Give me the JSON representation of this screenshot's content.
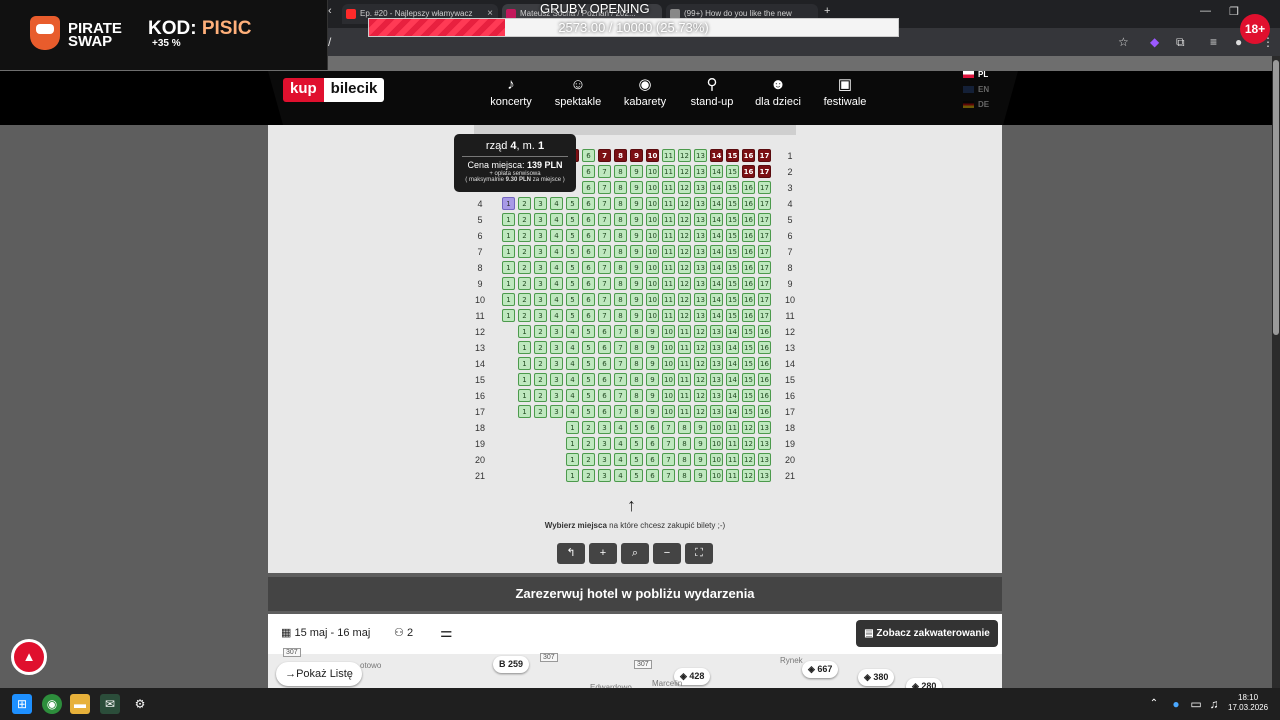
{
  "browser": {
    "tabs": [
      {
        "title": "Ep. #20 - Najlepszy włamywacz",
        "color": "#ff2a2a"
      },
      {
        "title": "Mateusz Socha / Poznań / 202...",
        "color": "#c2185b"
      },
      {
        "title": "(99+) How do you like the new",
        "color": "#888888"
      }
    ],
    "new_tab": "+",
    "url_fragment": "/"
  },
  "overlay": {
    "brand": "PIRATE SWAP",
    "code_prefix": "KOD:",
    "code": "PISIC",
    "bonus": "+35 %",
    "goal_title": "GRUBY OPENING",
    "goal_text": "2573.00 / 10000 (25.73%)",
    "goal_progress": 0.2573,
    "age": "18+"
  },
  "site": {
    "logo_left": "kup",
    "logo_right": "bilecik",
    "nav": [
      {
        "label": "koncerty",
        "icon": "music-note-icon",
        "glyph": "♪"
      },
      {
        "label": "spektakle",
        "icon": "theater-masks-icon",
        "glyph": "☺"
      },
      {
        "label": "kabarety",
        "icon": "speech-bubble-icon",
        "glyph": "◉"
      },
      {
        "label": "stand-up",
        "icon": "microphone-icon",
        "glyph": "⚲"
      },
      {
        "label": "dla dzieci",
        "icon": "child-face-icon",
        "glyph": "☻"
      },
      {
        "label": "festiwale",
        "icon": "speaker-icon",
        "glyph": "▣"
      }
    ],
    "languages": [
      {
        "code": "PL",
        "active": true
      },
      {
        "code": "EN",
        "active": false
      },
      {
        "code": "DE",
        "active": false
      }
    ]
  },
  "seatmap": {
    "tooltip": {
      "row_label": "rząd",
      "row": "4",
      "seat_label": "m.",
      "seat": "1",
      "price_label": "Cena miejsca:",
      "price": "139 PLN",
      "fee": "+ opłata serwisowa",
      "max_prefix": "( maksymalnie",
      "max_fee": "9.30 PLN",
      "max_suffix": "za miejsce )"
    },
    "rows": [
      {
        "row": "1",
        "start": 1,
        "count": 17,
        "taken": [
          1,
          2,
          3,
          4,
          5,
          7,
          8,
          9,
          10,
          14,
          15,
          16,
          17
        ],
        "hidden": [
          1,
          2,
          3,
          4
        ]
      },
      {
        "row": "2",
        "start": 1,
        "count": 17,
        "taken": [
          16,
          17
        ],
        "hidden": [
          1,
          2,
          3,
          4,
          5
        ]
      },
      {
        "row": "3",
        "start": 1,
        "count": 17,
        "taken": [],
        "hidden": [
          1,
          2,
          3,
          4,
          5
        ]
      },
      {
        "row": "4",
        "start": 1,
        "count": 17,
        "taken": [],
        "selected": [
          1
        ]
      },
      {
        "row": "5",
        "start": 1,
        "count": 17,
        "taken": []
      },
      {
        "row": "6",
        "start": 1,
        "count": 17,
        "taken": []
      },
      {
        "row": "7",
        "start": 1,
        "count": 17,
        "taken": []
      },
      {
        "row": "8",
        "start": 1,
        "count": 17,
        "taken": []
      },
      {
        "row": "9",
        "start": 1,
        "count": 17,
        "taken": []
      },
      {
        "row": "10",
        "start": 1,
        "count": 17,
        "taken": []
      },
      {
        "row": "11",
        "start": 1,
        "count": 17,
        "taken": []
      },
      {
        "row": "12",
        "start": 2,
        "count": 16,
        "taken": []
      },
      {
        "row": "13",
        "start": 2,
        "count": 16,
        "taken": []
      },
      {
        "row": "14",
        "start": 2,
        "count": 16,
        "taken": []
      },
      {
        "row": "15",
        "start": 2,
        "count": 16,
        "taken": []
      },
      {
        "row": "16",
        "start": 2,
        "count": 16,
        "taken": []
      },
      {
        "row": "17",
        "start": 2,
        "count": 16,
        "taken": []
      },
      {
        "row": "18",
        "start": 5,
        "count": 13,
        "taken": []
      },
      {
        "row": "19",
        "start": 5,
        "count": 13,
        "taken": []
      },
      {
        "row": "20",
        "start": 5,
        "count": 13,
        "taken": []
      },
      {
        "row": "21",
        "start": 5,
        "count": 13,
        "taken": []
      }
    ],
    "choose_bold": "Wybierz miejsca",
    "choose_rest": " na które chcesz zakupić bilety ;-)",
    "tools": [
      {
        "name": "undo-button",
        "glyph": "↰"
      },
      {
        "name": "add-button",
        "glyph": "+"
      },
      {
        "name": "zoom-out-button",
        "glyph": "⌕"
      },
      {
        "name": "remove-button",
        "glyph": "−"
      },
      {
        "name": "fullscreen-button",
        "glyph": "⛶"
      }
    ]
  },
  "hotel": {
    "title": "Zarezerwuj hotel w pobliżu wydarzenia",
    "dates": "15 maj - 16 maj",
    "guests": "2",
    "show_button": "Zobacz zakwaterowanie",
    "list_button": "Pokaż Listę",
    "pins": [
      "259",
      "428",
      "667",
      "380",
      "280"
    ],
    "roads": [
      "307",
      "307",
      "307"
    ],
    "map_labels": [
      "otowo",
      "Marcelin",
      "Edwardowo",
      "Rynek"
    ]
  },
  "taskbar": {
    "time": "18:10",
    "date": "17.03.2026"
  }
}
